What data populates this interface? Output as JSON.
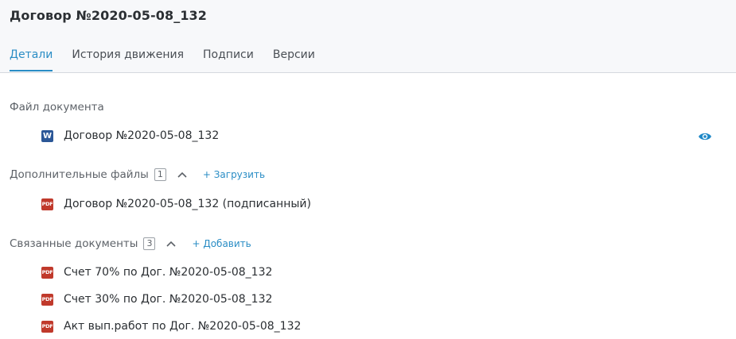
{
  "header": {
    "title": "Договор №2020-05-08_132",
    "tabs": [
      {
        "label": "Детали",
        "active": true
      },
      {
        "label": "История движения",
        "active": false
      },
      {
        "label": "Подписи",
        "active": false
      },
      {
        "label": "Версии",
        "active": false
      }
    ]
  },
  "document_file": {
    "section_title": "Файл документа",
    "file": {
      "name": "Договор №2020-05-08_132",
      "type_label": "W",
      "type": "word-icon"
    },
    "view_icon": "eye-icon"
  },
  "additional_files": {
    "section_title": "Дополнительные файлы",
    "count": "1",
    "upload_label": "+ Загрузить",
    "files": [
      {
        "name": "Договор №2020-05-08_132 (подписанный)",
        "type_label": "PDF",
        "type": "pdf-icon"
      }
    ]
  },
  "related_documents": {
    "section_title": "Связанные документы",
    "count": "3",
    "add_label": "+ Добавить",
    "files": [
      {
        "name": "Счет 70% по Дог. №2020-05-08_132",
        "type_label": "PDF",
        "type": "pdf-icon"
      },
      {
        "name": "Счет 30% по Дог. №2020-05-08_132",
        "type_label": "PDF",
        "type": "pdf-icon"
      },
      {
        "name": "Акт вып.работ по Дог. №2020-05-08_132",
        "type_label": "PDF",
        "type": "pdf-icon"
      }
    ]
  },
  "colors": {
    "accent": "#2a8dc5",
    "word": "#2b5797",
    "pdf": "#c0392b"
  }
}
